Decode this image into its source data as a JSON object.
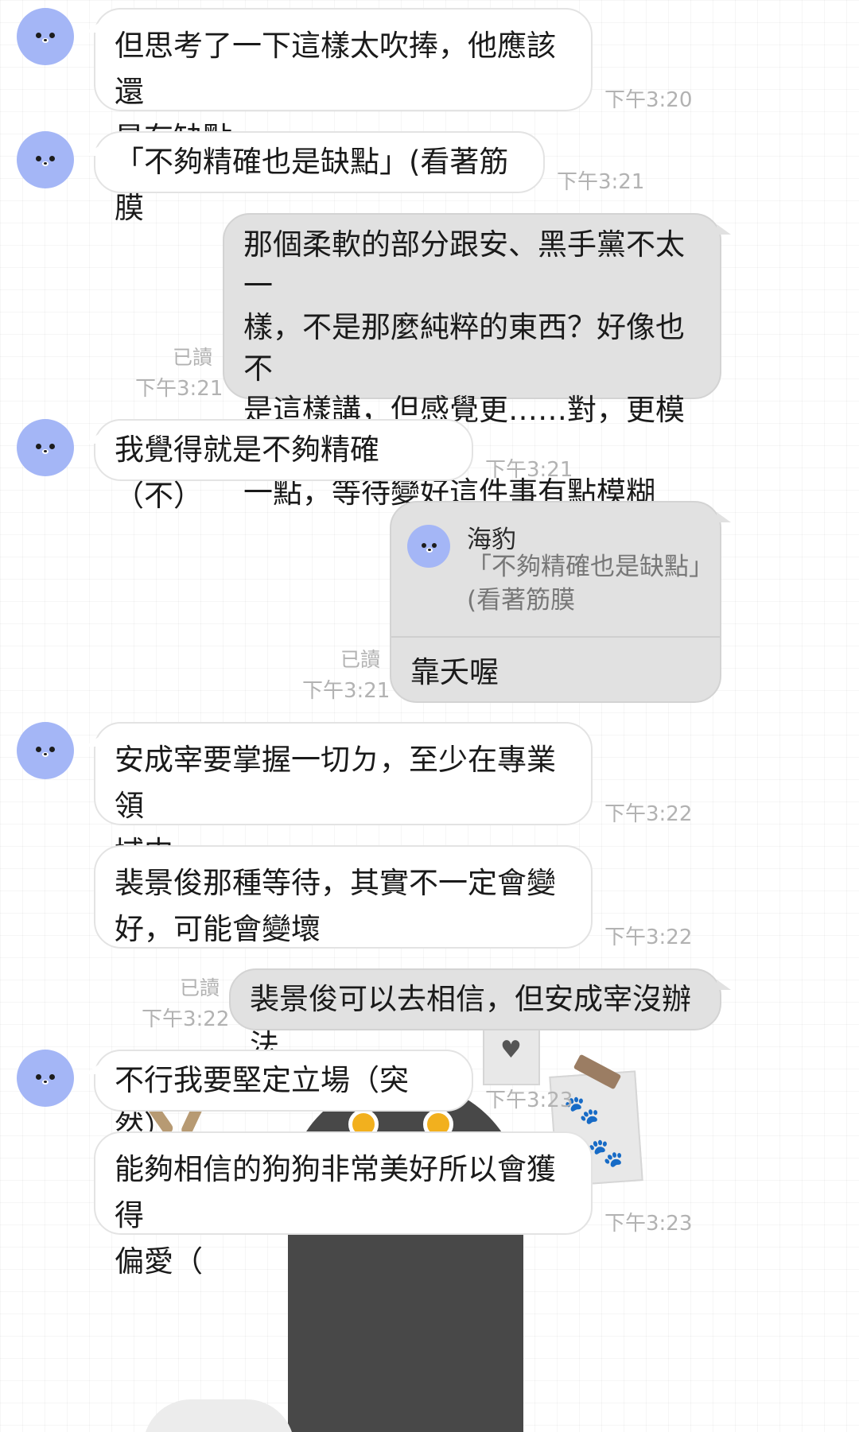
{
  "messages": {
    "m1": {
      "text": "但思考了一下這樣太吹捧，他應該還\n是有缺點",
      "time": "下午3:20"
    },
    "m2": {
      "text": "「不夠精確也是缺點」(看著筋膜",
      "time": "下午3:21"
    },
    "m3": {
      "text": "那個柔軟的部分跟安、黑手黨不太一\n樣，不是那麼純粹的東西？好像也不\n是這樣講，但感覺更……對，更模糊\n一點，等待變好這件事有點模糊",
      "read": "已讀",
      "time": "下午3:21"
    },
    "m4": {
      "text": "我覺得就是不夠精確（不）",
      "time": "下午3:21"
    },
    "m5": {
      "reply_name": "海豹",
      "reply_text": "「不夠精確也是缺點」\n(看著筋膜",
      "text": "靠夭喔",
      "read": "已讀",
      "time": "下午3:21"
    },
    "m6": {
      "text": "安成宰要掌握一切ㄉ，至少在專業領\n域中",
      "time": "下午3:22"
    },
    "m7": {
      "text": "裴景俊那種等待，其實不一定會變\n好，可能會變壞",
      "time": "下午3:22"
    },
    "m8": {
      "text": "裴景俊可以去相信，但安成宰沒辦法",
      "read": "已讀",
      "time": "下午3:22"
    },
    "m9": {
      "text": "不行我要堅定立場（突然）",
      "time": "下午3:23"
    },
    "m10": {
      "text": "能夠相信的狗狗非常美好所以會獲得\n偏愛（",
      "time": "下午3:23"
    }
  },
  "colors": {
    "avatar": "#a4b6f6",
    "incoming_bubble": "#ffffff",
    "outgoing_bubble": "#e1e1e1",
    "timestamp": "#b2b2b2"
  },
  "icons": [
    "seal-avatar-icon",
    "paw-print-icon",
    "heart-icon"
  ]
}
